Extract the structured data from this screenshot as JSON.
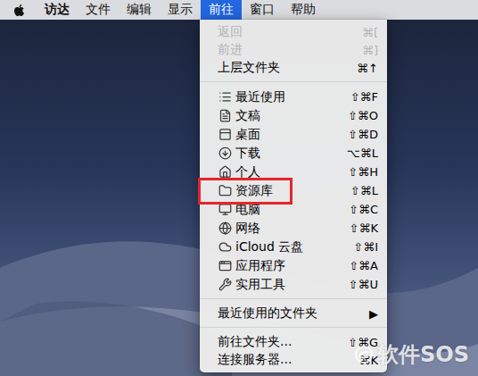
{
  "menubar": {
    "app_name": "访达",
    "items": [
      {
        "label": "文件",
        "selected": false
      },
      {
        "label": "编辑",
        "selected": false
      },
      {
        "label": "显示",
        "selected": false
      },
      {
        "label": "前往",
        "selected": true
      },
      {
        "label": "窗口",
        "selected": false
      },
      {
        "label": "帮助",
        "selected": false
      }
    ]
  },
  "menu": {
    "sections": [
      {
        "items": [
          {
            "label": "返回",
            "shortcut": "⌘[",
            "disabled": true,
            "boxed": false
          },
          {
            "label": "前进",
            "shortcut": "⌘]",
            "disabled": true,
            "boxed": false
          },
          {
            "label": "上层文件夹",
            "shortcut": "⌘↑",
            "disabled": false,
            "boxed": false
          }
        ]
      },
      {
        "items": [
          {
            "label": "最近使用",
            "shortcut": "⇧⌘F",
            "disabled": false,
            "boxed": false
          },
          {
            "label": "文稿",
            "shortcut": "⇧⌘O",
            "disabled": false,
            "boxed": false
          },
          {
            "label": "桌面",
            "shortcut": "⇧⌘D",
            "disabled": false,
            "boxed": false
          },
          {
            "label": "下载",
            "shortcut": "⌥⌘L",
            "disabled": false,
            "boxed": false
          },
          {
            "label": "个人",
            "shortcut": "⇧⌘H",
            "disabled": false,
            "boxed": false
          },
          {
            "label": "资源库",
            "shortcut": "⇧⌘L",
            "disabled": false,
            "boxed": true
          },
          {
            "label": "电脑",
            "shortcut": "⇧⌘C",
            "disabled": false,
            "boxed": false
          },
          {
            "label": "网络",
            "shortcut": "⇧⌘K",
            "disabled": false,
            "boxed": false
          },
          {
            "label": "iCloud 云盘",
            "shortcut": "⇧⌘I",
            "disabled": false,
            "boxed": false
          },
          {
            "label": "应用程序",
            "shortcut": "⇧⌘A",
            "disabled": false,
            "boxed": false
          },
          {
            "label": "实用工具",
            "shortcut": "⇧⌘U",
            "disabled": false,
            "boxed": false
          }
        ]
      },
      {
        "items": [
          {
            "label": "最近使用的文件夹",
            "shortcut": "▶",
            "disabled": false,
            "boxed": false
          }
        ]
      },
      {
        "items": [
          {
            "label": "前往文件夹...",
            "shortcut": "⇧⌘G",
            "disabled": false,
            "boxed": false
          },
          {
            "label": "连接服务器...",
            "shortcut": "⌘K",
            "disabled": false,
            "boxed": false
          }
        ]
      }
    ]
  },
  "watermark": {
    "text": "软件SOS"
  }
}
